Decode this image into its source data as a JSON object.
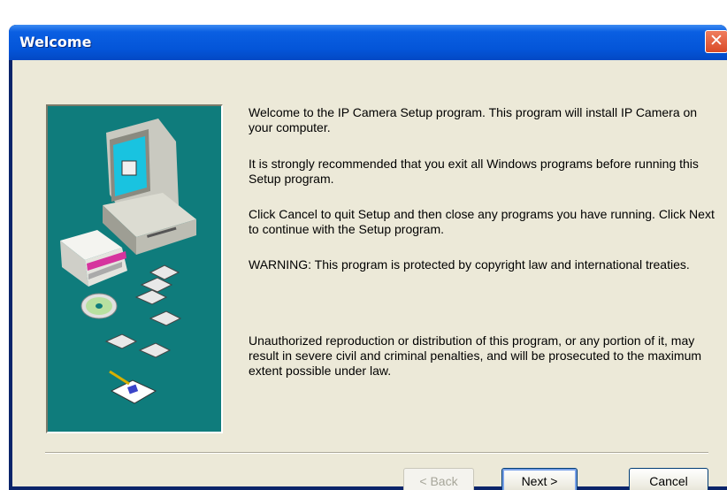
{
  "window": {
    "title": "Welcome"
  },
  "content": {
    "paragraphs": [
      "Welcome to the IP Camera Setup program. This program will install IP Camera on your computer.",
      "It is strongly recommended that you exit all Windows programs before running this Setup program.",
      "Click Cancel to quit Setup and then close any programs you have running. Click Next to continue with the Setup program.",
      "WARNING: This program is protected by copyright law and international treaties.",
      "Unauthorized reproduction or distribution of this program, or any portion of it, may result in severe civil and criminal penalties, and will be prosecuted to the maximum extent possible under law."
    ]
  },
  "buttons": {
    "back": "< Back",
    "next": "Next >",
    "cancel": "Cancel"
  },
  "icons": {
    "close": "close-icon",
    "illustration": "setup-computer-illustration"
  },
  "colors": {
    "title_bar": "#0455d8",
    "close_button": "#d94a26",
    "panel_bg": "#0f7c7c",
    "dialog_bg": "#ece9d8"
  }
}
